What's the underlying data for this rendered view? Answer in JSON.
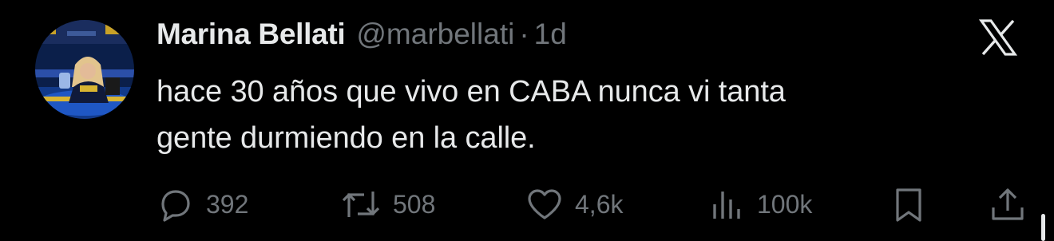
{
  "author": {
    "name": "Marina Bellati",
    "handle": "@marbellati",
    "separator": "·",
    "time": "1d"
  },
  "tweet": {
    "line1": "hace 30 años que vivo en CABA nunca vi tanta",
    "line2": "gente durmiendo en la calle."
  },
  "actions": {
    "replies": "392",
    "reposts": "508",
    "likes": "4,6k",
    "views": "100k"
  },
  "icons": {
    "platform": "x-logo-icon",
    "reply": "reply-icon",
    "repost": "repost-icon",
    "like": "heart-icon",
    "views": "views-icon",
    "bookmark": "bookmark-icon",
    "share": "share-icon"
  },
  "colors": {
    "background": "#000000",
    "primary_text": "#e7e9ea",
    "secondary_text": "#71767b"
  }
}
